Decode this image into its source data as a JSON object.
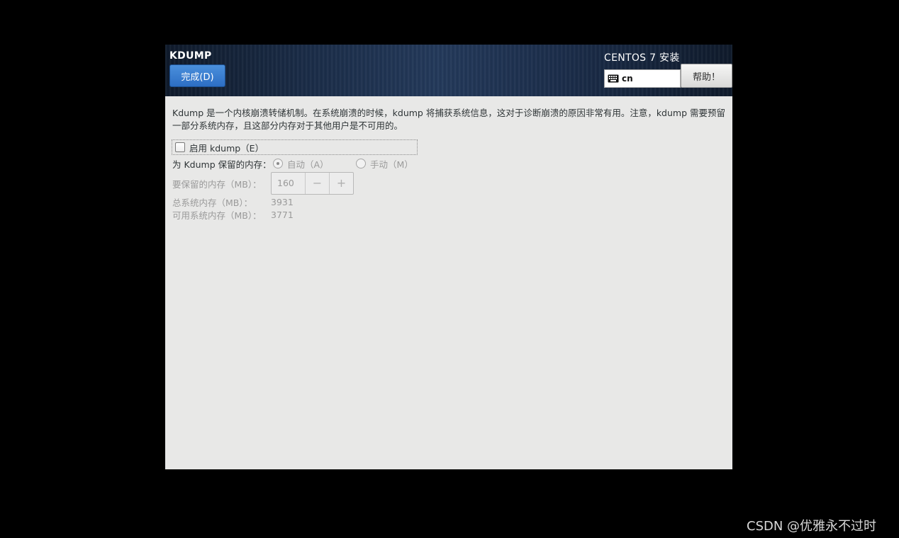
{
  "header": {
    "screen_title": "KDUMP",
    "done_label": "完成(D)",
    "product_title": "CENTOS 7 安装",
    "keyboard_layout": "cn",
    "help_label": "帮助！"
  },
  "main": {
    "description": "Kdump 是一个内核崩溃转储机制。在系统崩溃的时候，kdump 将捕获系统信息，这对于诊断崩溃的原因非常有用。注意，kdump 需要预留一部分系统内存，且这部分内存对于其他用户是不可用的。",
    "enable_label": "启用 kdump（E）",
    "enable_checked": false,
    "reserve_label": "为 Kdump 保留的内存：",
    "auto_label": "自动（A）",
    "manual_label": "手动（M）",
    "reserved_memory_label": "要保留的内存（MB）：",
    "reserved_memory_value": "160",
    "minus_label": "−",
    "plus_label": "+",
    "total_memory_label": "总系统内存（MB）：",
    "total_memory_value": "3931",
    "usable_memory_label": "可用系统内存（MB）：",
    "usable_memory_value": "3771"
  },
  "watermark": "CSDN @󠄀优雅永不过时",
  "colors": {
    "primary_button": "#3a7fd0",
    "header_dark": "#0f1a2b",
    "panel_bg": "#e8e8e7"
  }
}
